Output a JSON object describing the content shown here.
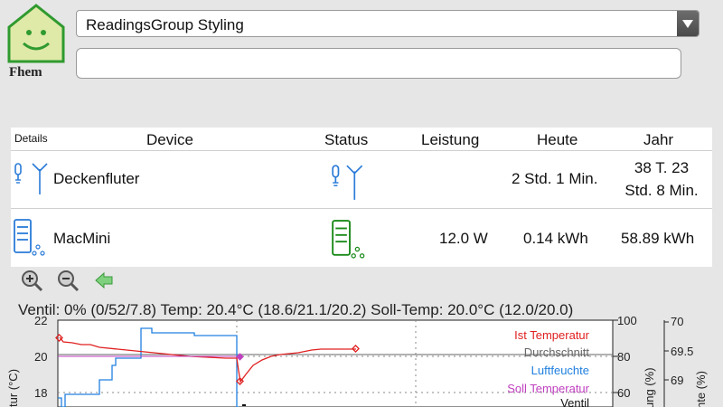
{
  "logo": {
    "text": "Fhem",
    "icon": "house-smiley-icon"
  },
  "room_select": {
    "value": "ReadingsGroup Styling"
  },
  "command_input": {
    "value": ""
  },
  "readings_group": {
    "details_label": "Details",
    "headers": [
      "Device",
      "Status",
      "Leistung",
      "Heute",
      "Jahr"
    ],
    "rows": [
      {
        "device": "Deckenfluter",
        "icon": "lamp-antenna-icon",
        "status_icon": "lamp-antenna-icon",
        "leistung": "",
        "heute": "2 Std. 1 Min.",
        "jahr_line1": "38 T. 23",
        "jahr_line2": "Std. 8 Min."
      },
      {
        "device": "MacMini",
        "icon": "server-network-icon",
        "status_icon": "server-network-icon",
        "leistung": "12.0 W",
        "heute": "0.14 kWh",
        "jahr": "58.89 kWh"
      }
    ]
  },
  "plot": {
    "title": "Ventil: 0% (0/52/7.8) Temp: 20.4°C (18.6/21.1/20.2) Soll-Temp: 20.0°C (12.0/20.0)",
    "controls": [
      "zoom-in-icon",
      "zoom-out-icon",
      "back-arrow-icon"
    ],
    "colors": {
      "ist": "#e02020",
      "durchschnitt": "#666666",
      "luftfeuchte": "#2080e0",
      "soll": "#c040c0",
      "ventil": "#111111"
    }
  },
  "chart_data": {
    "type": "line",
    "y_left": {
      "label": "tur (°C)",
      "ticks": [
        22,
        20,
        18
      ]
    },
    "y_right1": {
      "label": "ung (%)",
      "ticks": [
        100,
        80,
        60
      ]
    },
    "y_right2": {
      "label": "hte (%)",
      "ticks": [
        70,
        69.5,
        69
      ]
    },
    "legend": [
      "Ist Temperatur",
      "Durchschnitt",
      "Luftfeuchte",
      "Soll Temperatur",
      "Ventil"
    ],
    "series": [
      {
        "name": "Ist Temperatur",
        "values": [
          21.0,
          20.7,
          20.4,
          20.1,
          20.0,
          19.9,
          19.8,
          19.8,
          18.6,
          19.5,
          20.2,
          20.4,
          20.4,
          20.4,
          20.4
        ]
      },
      {
        "name": "Durchschnitt",
        "values": [
          20.2
        ]
      },
      {
        "name": "Luftfeuchte",
        "values": [
          66,
          58,
          68,
          80,
          88,
          92,
          94,
          94,
          58,
          52,
          52,
          52,
          52,
          52,
          52
        ]
      },
      {
        "name": "Soll Temperatur",
        "values": [
          20.0,
          20.0
        ]
      }
    ]
  }
}
